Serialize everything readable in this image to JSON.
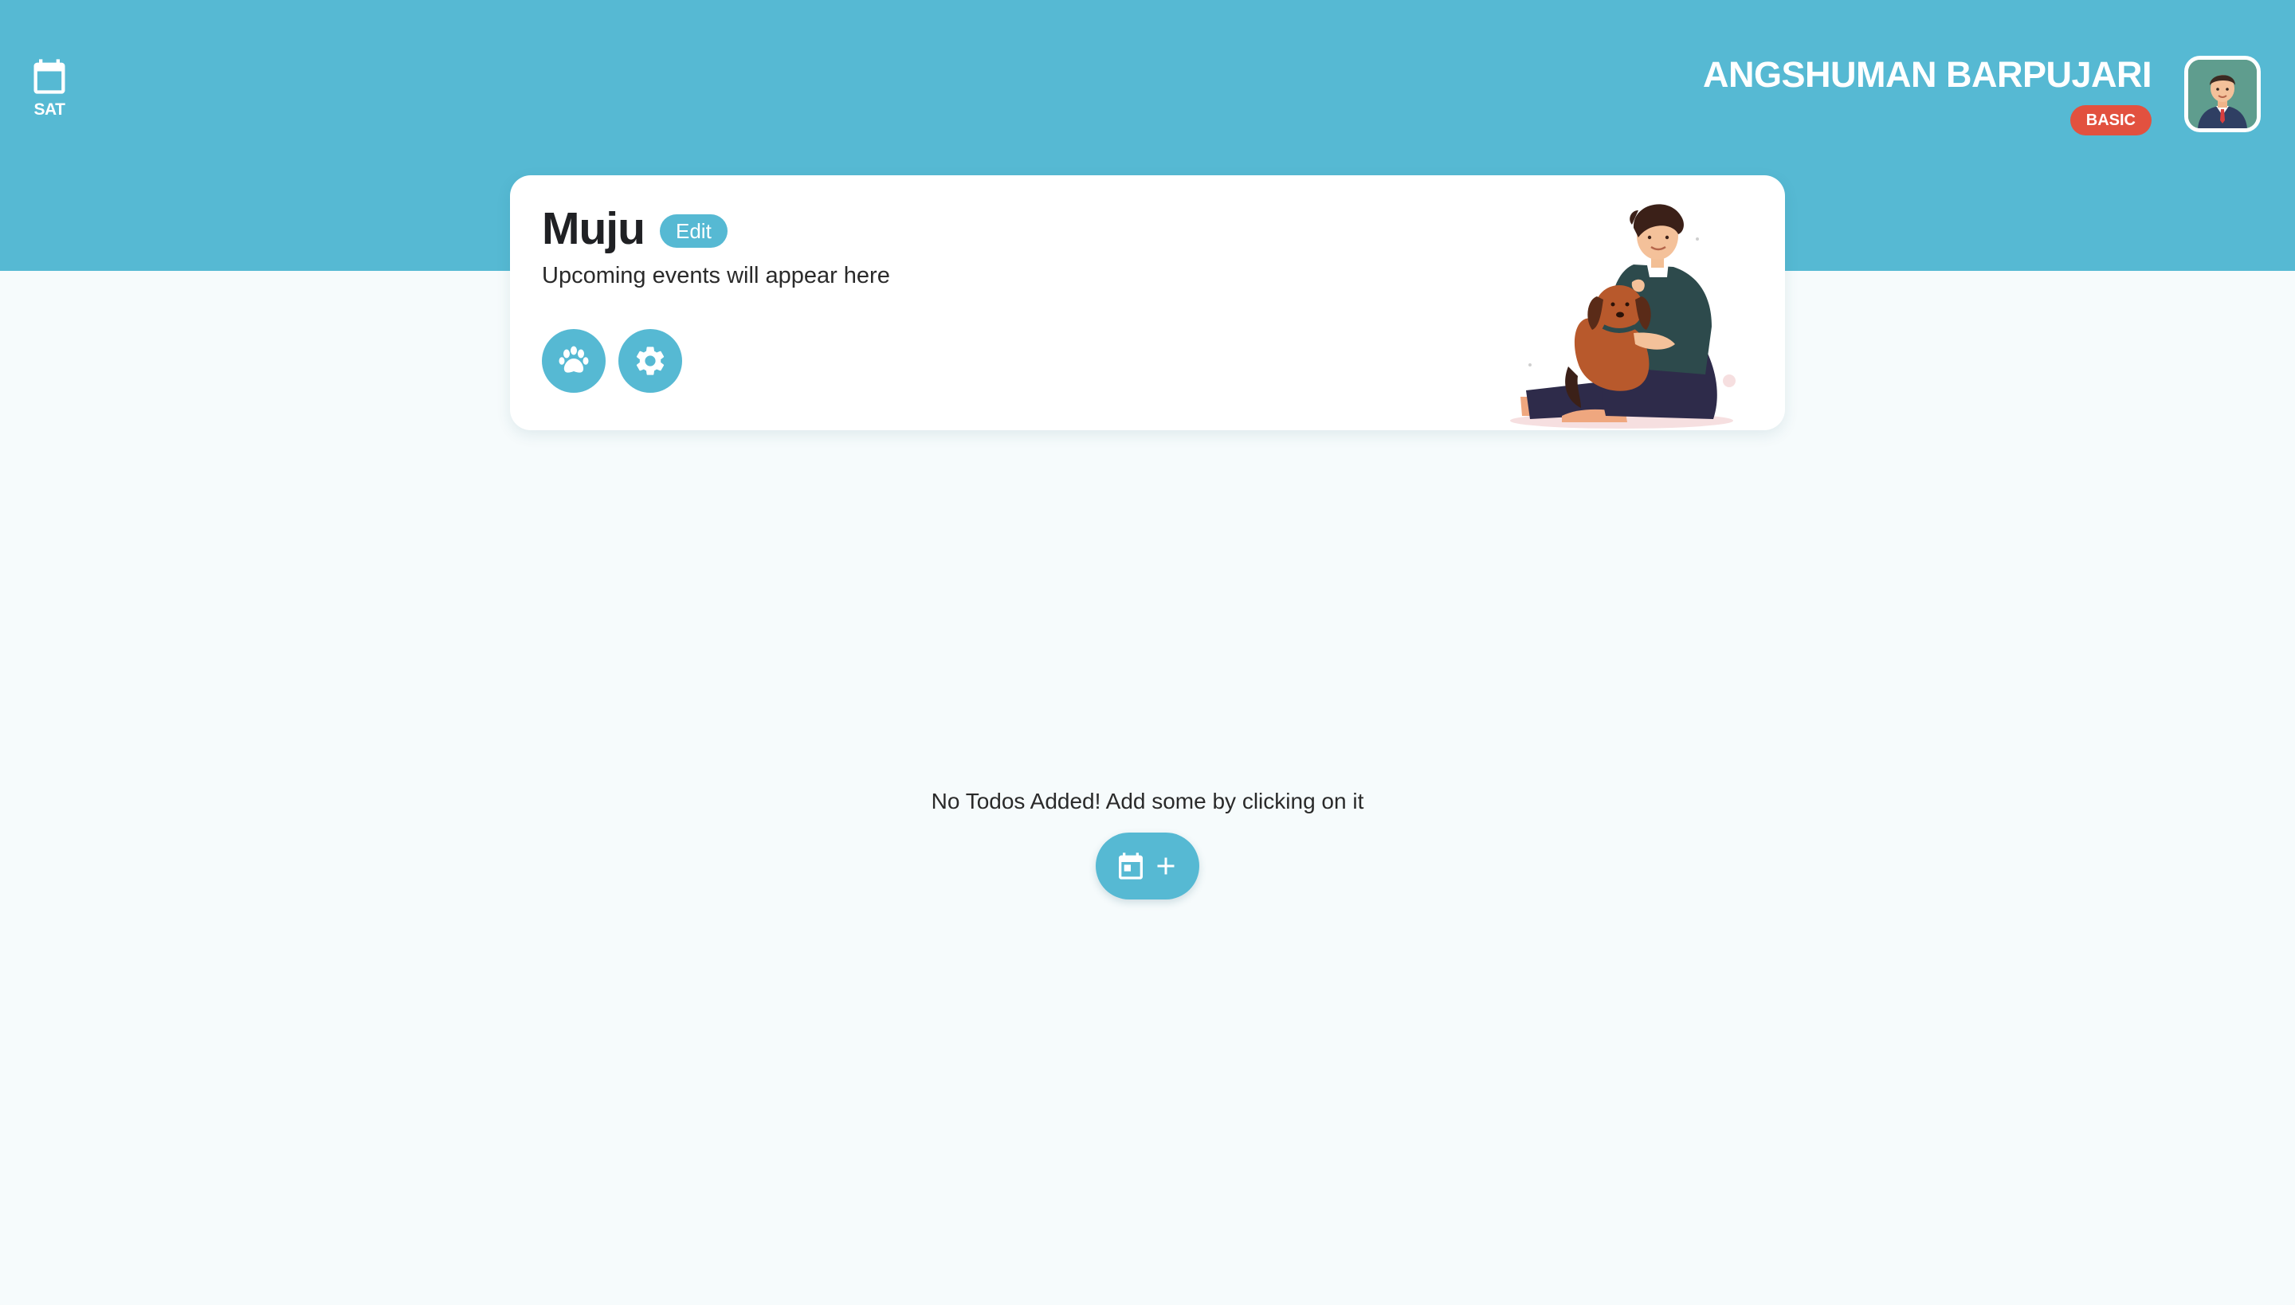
{
  "header": {
    "day": "SAT",
    "user_name": "ANGSHUMAN BARPUJARI",
    "plan_badge": "BASIC"
  },
  "pet_card": {
    "name": "Muju",
    "edit_label": "Edit",
    "events_text": "Upcoming events will appear here"
  },
  "todos": {
    "empty_message": "No Todos Added! Add some by clicking on it"
  },
  "colors": {
    "primary": "#56b9d3",
    "badge": "#e2513f",
    "page_background": "#f6fbfc",
    "card_background": "#ffffff"
  },
  "icons": {
    "day": "calendar-icon",
    "avatar": "user-avatar",
    "pet": "paw-icon",
    "settings": "gear-icon",
    "add_todo": [
      "calendar-icon",
      "plus-icon"
    ]
  }
}
